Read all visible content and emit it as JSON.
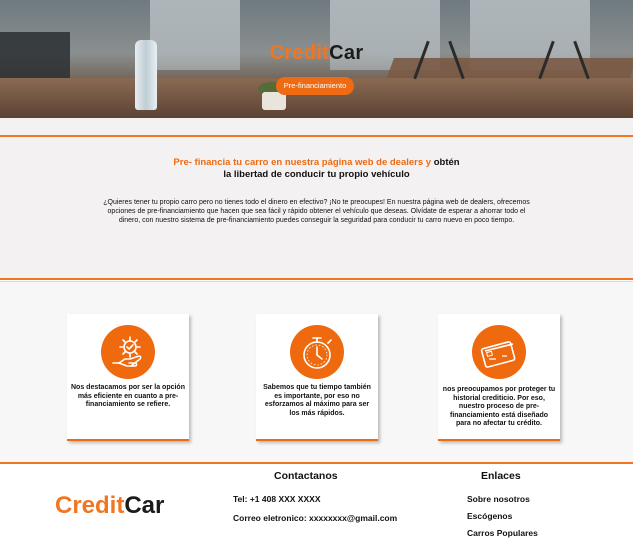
{
  "hero": {
    "brand_part1": "Credit",
    "brand_part2": "Car",
    "cta_label": "Pre-financiamiento"
  },
  "intro": {
    "heading_orange": "Pre- financia tu carro en nuestra página web de dealers y",
    "heading_dark_1": "obtén",
    "heading_dark_2": "la libertad de conducir tu propio vehículo",
    "body": "¿Quieres tener tu propio carro pero no tienes todo el dinero en efectivo? ¡No te preocupes! En nuestra página web de dealers, ofrecemos opciones de pre-financiamiento que hacen que sea fácil y rápido obtener el vehículo que deseas. Olvídate de esperar a ahorrar todo el dinero, con nuestro sistema de pre-financiamiento puedes conseguir la seguridad para conducir tu carro nuevo en poco tiempo."
  },
  "features": [
    {
      "icon": "hand-gear-icon",
      "text": "Nos destacamos por ser la opción más eficiente en cuanto a pre-financiamiento se refiere."
    },
    {
      "icon": "stopwatch-icon",
      "text": "Sabemos que tu tiempo también es importante, por eso no esforzamos al máximo para ser los más rápidos."
    },
    {
      "icon": "credit-card-icon",
      "text": "nos preocupamos por proteger tu historial crediticio. Por eso, nuestro proceso de pre-financiamiento está diseñado para no afectar tu crédito."
    }
  ],
  "footer": {
    "logo_part1": "Credit",
    "logo_part2": "Car",
    "contact_title": "Contactanos",
    "phone": "Tel: +1 408 XXX XXXX",
    "email": "Correo eletronico: xxxxxxxx@gmail.com",
    "links_title": "Enlaces",
    "links": [
      "Sobre nosotros",
      "Escógenos",
      "Carros Populares"
    ]
  },
  "colors": {
    "accent": "#ee6b14",
    "rule": "#f07623",
    "intro_bg": "#f3f1f1"
  }
}
